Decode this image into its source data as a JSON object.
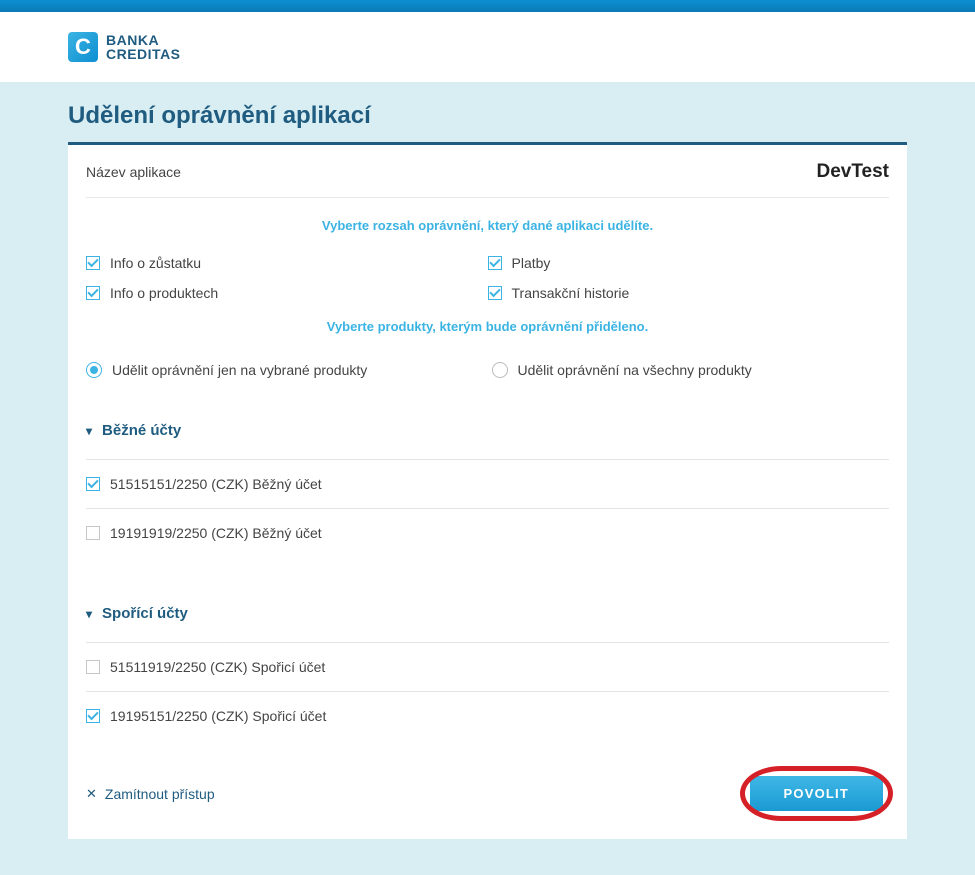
{
  "brand": {
    "line1": "BANKA",
    "line2": "CREDITAS",
    "mark": "C"
  },
  "page_title": "Udělení oprávnění aplikací",
  "app_label": "Název aplikace",
  "app_name": "DevTest",
  "hint_permissions": "Vyberte rozsah oprávnění, který dané aplikaci udělíte.",
  "permissions": {
    "balance": "Info o zůstatku",
    "payments": "Platby",
    "products": "Info o produktech",
    "transactions": "Transakční historie"
  },
  "hint_products": "Vyberte produkty, kterým bude oprávnění přiděleno.",
  "scope": {
    "selected": "Udělit oprávnění jen na vybrané produkty",
    "all": "Udělit oprávnění na všechny produkty"
  },
  "sections": {
    "current": "Běžné účty",
    "savings": "Spořící účty"
  },
  "accounts": {
    "current": [
      {
        "label": "51515151/2250 (CZK) Běžný účet",
        "checked": true
      },
      {
        "label": "19191919/2250 (CZK) Běžný účet",
        "checked": false
      }
    ],
    "savings": [
      {
        "label": "51511919/2250 (CZK) Spořicí účet",
        "checked": false
      },
      {
        "label": "19195151/2250 (CZK) Spořicí účet",
        "checked": true
      }
    ]
  },
  "actions": {
    "deny": "Zamítnout přístup",
    "approve": "POVOLIT"
  }
}
